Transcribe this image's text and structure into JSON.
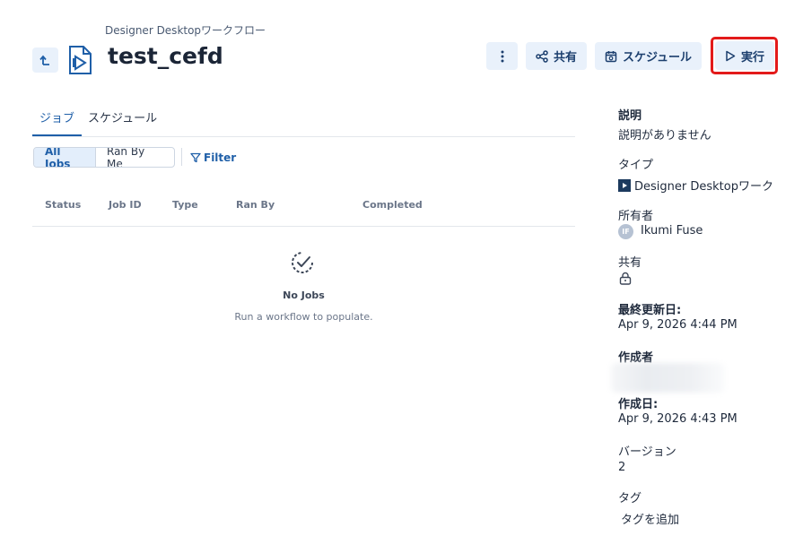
{
  "header": {
    "subtitle": "Designer Desktopワークフロー",
    "title": "test_cefd",
    "share_label": "共有",
    "schedule_label": "スケジュール",
    "run_label": "実行"
  },
  "tabs": {
    "jobs": "ジョブ",
    "schedule": "スケジュール"
  },
  "filters": {
    "all_jobs": "All Jobs",
    "ran_by_me": "Ran By Me",
    "filter": "Filter"
  },
  "table": {
    "columns": [
      "Status",
      "Job ID",
      "Type",
      "Ran By",
      "Completed"
    ]
  },
  "empty": {
    "title": "No Jobs",
    "subtitle": "Run a workflow to populate."
  },
  "details": {
    "description_label": "説明",
    "description_value": "説明がありません",
    "type_label": "タイプ",
    "type_value": "Designer Desktopワーク",
    "owner_label": "所有者",
    "owner_initials": "IF",
    "owner_name": "Ikumi Fuse",
    "shared_label": "共有",
    "updated_label": "最終更新日:",
    "updated_value": "Apr 9, 2026 4:44 PM",
    "creator_label": "作成者",
    "created_label": "作成日:",
    "created_value": "Apr 9, 2026 4:43 PM",
    "version_label": "バージョン",
    "version_value": "2",
    "tags_label": "タグ",
    "add_tag": "タグを追加"
  },
  "colors": {
    "accent": "#1f5fa8",
    "highlight": "#e31a1a",
    "button_bg": "#e9f1fb"
  }
}
